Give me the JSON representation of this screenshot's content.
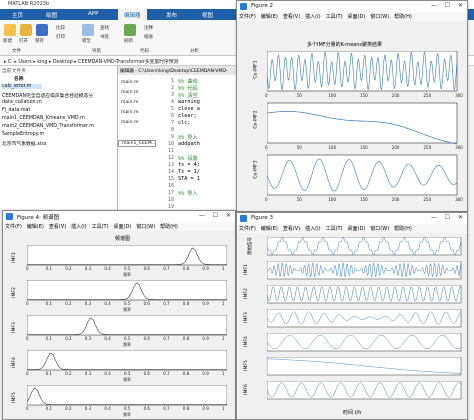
{
  "matlab": {
    "title": "MATLAB R2023b",
    "tabs": [
      "主页",
      "绘图",
      "APP",
      "编辑器",
      "发布",
      "视图"
    ],
    "active_tab": "编辑器",
    "ribbon_groups": [
      "文件",
      "导航",
      "代码",
      "分析"
    ],
    "ribbon_buttons": [
      "新建",
      "打开",
      "保存",
      "比较",
      "打印",
      "转至",
      "查找",
      "书签",
      "刷新",
      "注释",
      "缩进"
    ],
    "address": "▸ C: ▸ Users ▸ king ▸ Desktop ▸ CEEMDAN-VMD-Transformer多变量时序预测",
    "current_folder_label": "当前文件夹",
    "name_header": "名称",
    "files": [
      "calc_error.m",
      "CEEMDAN完全自适应噪声集合经验模态分",
      "data_collation.m",
      "Fj_data.mat",
      "main1_CEEMDAN_Kmeans_VMD.m",
      "main2_CEEMDAN_VMD_Transformer.m",
      "SampleEntropy.m",
      "北京市气象数据.xlsx"
    ],
    "editor_path": "编辑器 - C:\\Users\\king\\Desktop\\CEEMDAN-VMD-",
    "editor_tabs": [
      "main.m",
      "main.m",
      "main.m",
      "main.m",
      "main.m",
      "main1_CEEM..."
    ],
    "line_numbers": [
      "1",
      "2",
      "3",
      "4",
      "5",
      "6",
      "7",
      "8",
      "9",
      "10",
      "11",
      "12",
      "13",
      "14",
      "15",
      "16",
      "17",
      "18",
      "19"
    ],
    "code_lines": [
      "%% 曲线",
      "%% 代码",
      "%% 清空",
      "warning",
      "close a",
      "clear;",
      "clc;",
      "",
      "%% 导入",
      "addpath",
      "",
      "%% 设置",
      "fs = 4;",
      "Ts = 1/",
      "STA = 1",
      "",
      "%% 导入",
      "",
      ""
    ]
  },
  "figure2": {
    "title": "Figure 2",
    "menu": [
      "文件(F)",
      "编辑(E)",
      "查看(V)",
      "插入(I)",
      "工具(T)",
      "桌面(D)",
      "窗口(W)",
      "帮助(H)"
    ],
    "plot_title": "多个IMF分量的K-means聚类结果",
    "ylabels": [
      "Co-IMF1",
      "Co-IMF2",
      "Co-IMF3"
    ],
    "xticks": [
      "0",
      "50",
      "100",
      "150",
      "200",
      "250",
      "300"
    ]
  },
  "figure4": {
    "title": "Figure 4: 频谱图",
    "menu": [
      "文件(F)",
      "编辑(E)",
      "查看(V)",
      "插入(I)",
      "工具(T)",
      "桌面(D)",
      "窗口(W)",
      "帮助(H)"
    ],
    "plot_title": "频谱图",
    "xlabel": "频率",
    "ylabels": [
      "IMF1",
      "IMF2",
      "IMF3",
      "IMF4",
      "IMF5"
    ],
    "xticks": [
      "0",
      "0.1",
      "0.2",
      "0.3",
      "0.4",
      "0.5",
      "0.6",
      "0.7",
      "0.8",
      "0.9",
      "1"
    ]
  },
  "figure3": {
    "title": "Figure 3",
    "menu": [
      "文件(F)",
      "编辑(E)",
      "查看(V)",
      "插入(I)",
      "工具(T)",
      "桌面(D)",
      "窗口(W)",
      "帮助(H)"
    ],
    "ylabels": [
      "原始信号",
      "IMF1",
      "IMF2",
      "IMF3",
      "IMF4",
      "IMF5",
      "IMF6"
    ],
    "xlabel": "时间 t/h"
  },
  "colors": {
    "accent": "#1f5ea8",
    "line": "#3a7bbf",
    "spectrum": "#3b3b3b"
  }
}
